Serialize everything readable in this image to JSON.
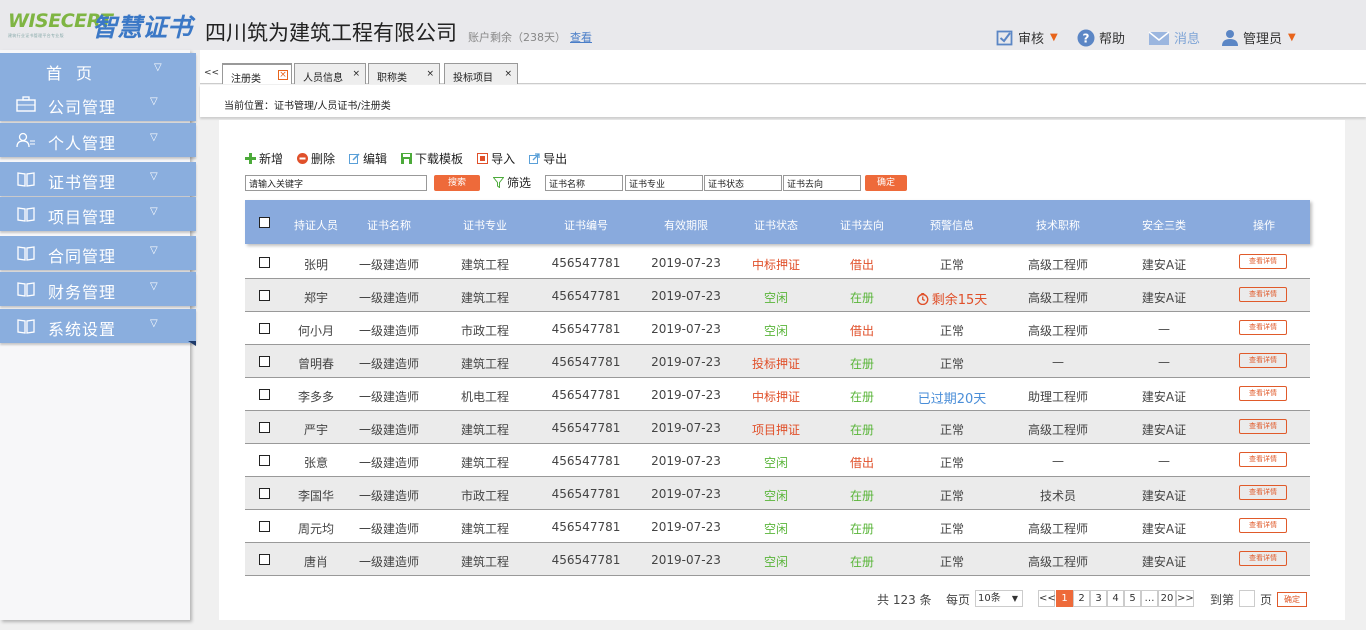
{
  "logo": {
    "en": "WISECERT",
    "cn": "智慧证书",
    "tagline": "建筑行业证书管理平台专业版"
  },
  "header": {
    "company": "四川筑为建筑工程有限公司",
    "account": "账户剩余（238天）",
    "view_link": "查看",
    "items": [
      {
        "label": "审核",
        "icon": "checkbox-icon"
      },
      {
        "label": "帮助",
        "icon": "help-icon"
      },
      {
        "label": "消息",
        "icon": "mail-icon"
      },
      {
        "label": "管理员",
        "icon": "user-icon"
      }
    ]
  },
  "sidebar": {
    "items": [
      {
        "label": "首页",
        "icon": "none"
      },
      {
        "label": "公司管理",
        "icon": "briefcase-icon"
      },
      {
        "label": "个人管理",
        "icon": "person-icon"
      },
      {
        "label": "证书管理",
        "icon": "book-icon"
      },
      {
        "label": "项目管理",
        "icon": "book-icon"
      },
      {
        "label": "合同管理",
        "icon": "book-icon"
      },
      {
        "label": "财务管理",
        "icon": "book-icon"
      },
      {
        "label": "系统设置",
        "icon": "book-icon"
      }
    ],
    "chevron": "▽"
  },
  "tabs": {
    "back": "<<",
    "items": [
      {
        "label": "注册类"
      },
      {
        "label": "人员信息"
      },
      {
        "label": "职称类"
      },
      {
        "label": "投标项目"
      }
    ],
    "close": "×"
  },
  "breadcrumb": "当前位置：证书管理/人员证书/注册类",
  "toolbar": {
    "add": "新增",
    "delete": "删除",
    "edit": "编辑",
    "download": "下载模板",
    "import": "导入",
    "export": "导出"
  },
  "filter": {
    "keyword_value": "请输入关键字",
    "search": "搜索",
    "filter_label": "筛选",
    "f1": "证书名称",
    "f2": "证书专业",
    "f3": "证书状态",
    "f4": "证书去向",
    "confirm": "确定"
  },
  "table": {
    "headers": [
      "持证人员",
      "证书名称",
      "证书专业",
      "证书编号",
      "有效期限",
      "证书状态",
      "证书去向",
      "预警信息",
      "技术职称",
      "安全三类",
      "操作"
    ],
    "detail_label": "查看详情",
    "rows": [
      {
        "name": "张明",
        "cert": "一级建造师",
        "major": "建筑工程",
        "no": "456547781",
        "date": "2019-07-23",
        "status": "中标押证",
        "status_color": "red",
        "dest": "借出",
        "dest_color": "red",
        "warn": "正常",
        "warn_color": "",
        "title": "高级工程师",
        "safety": "建安A证"
      },
      {
        "name": "郑宇",
        "cert": "一级建造师",
        "major": "建筑工程",
        "no": "456547781",
        "date": "2019-07-23",
        "status": "空闲",
        "status_color": "green",
        "dest": "在册",
        "dest_color": "green",
        "warn": "剩余15天",
        "warn_color": "red",
        "title": "高级工程师",
        "safety": "建安A证"
      },
      {
        "name": "何小月",
        "cert": "一级建造师",
        "major": "市政工程",
        "no": "456547781",
        "date": "2019-07-23",
        "status": "空闲",
        "status_color": "green",
        "dest": "借出",
        "dest_color": "red",
        "warn": "正常",
        "warn_color": "",
        "title": "高级工程师",
        "safety": "—"
      },
      {
        "name": "曾明春",
        "cert": "一级建造师",
        "major": "建筑工程",
        "no": "456547781",
        "date": "2019-07-23",
        "status": "投标押证",
        "status_color": "red",
        "dest": "在册",
        "dest_color": "green",
        "warn": "正常",
        "warn_color": "",
        "title": "—",
        "safety": "—"
      },
      {
        "name": "李多多",
        "cert": "一级建造师",
        "major": "机电工程",
        "no": "456547781",
        "date": "2019-07-23",
        "status": "中标押证",
        "status_color": "red",
        "dest": "在册",
        "dest_color": "green",
        "warn": "已过期20天",
        "warn_color": "blue",
        "title": "助理工程师",
        "safety": "建安A证"
      },
      {
        "name": "严宇",
        "cert": "一级建造师",
        "major": "建筑工程",
        "no": "456547781",
        "date": "2019-07-23",
        "status": "项目押证",
        "status_color": "red",
        "dest": "在册",
        "dest_color": "green",
        "warn": "正常",
        "warn_color": "",
        "title": "高级工程师",
        "safety": "建安A证"
      },
      {
        "name": "张意",
        "cert": "一级建造师",
        "major": "建筑工程",
        "no": "456547781",
        "date": "2019-07-23",
        "status": "空闲",
        "status_color": "green",
        "dest": "借出",
        "dest_color": "red",
        "warn": "正常",
        "warn_color": "",
        "title": "—",
        "safety": "—"
      },
      {
        "name": "李国华",
        "cert": "一级建造师",
        "major": "市政工程",
        "no": "456547781",
        "date": "2019-07-23",
        "status": "空闲",
        "status_color": "green",
        "dest": "在册",
        "dest_color": "green",
        "warn": "正常",
        "warn_color": "",
        "title": "技术员",
        "safety": "建安A证"
      },
      {
        "name": "周元均",
        "cert": "一级建造师",
        "major": "建筑工程",
        "no": "456547781",
        "date": "2019-07-23",
        "status": "空闲",
        "status_color": "green",
        "dest": "在册",
        "dest_color": "green",
        "warn": "正常",
        "warn_color": "",
        "title": "高级工程师",
        "safety": "建安A证"
      },
      {
        "name": "唐肖",
        "cert": "一级建造师",
        "major": "建筑工程",
        "no": "456547781",
        "date": "2019-07-23",
        "status": "空闲",
        "status_color": "green",
        "dest": "在册",
        "dest_color": "green",
        "warn": "正常",
        "warn_color": "",
        "title": "高级工程师",
        "safety": "建安A证"
      }
    ]
  },
  "pager": {
    "total": "共 123 条",
    "per_page_label": "每页",
    "per_page_value": "10条",
    "prev": "<<",
    "pages": [
      "1",
      "2",
      "3",
      "4",
      "5",
      "…",
      "20"
    ],
    "current": "1",
    "next": ">>",
    "goto_label": "到第",
    "page_unit": "页",
    "confirm": "确定"
  },
  "colors": {
    "accent": "#ee6a3a",
    "nav": "#8aaede",
    "head": "#89aadd",
    "status_red": "#e0502a",
    "status_green": "#5ab53a",
    "status_blue": "#4a8ed8"
  }
}
